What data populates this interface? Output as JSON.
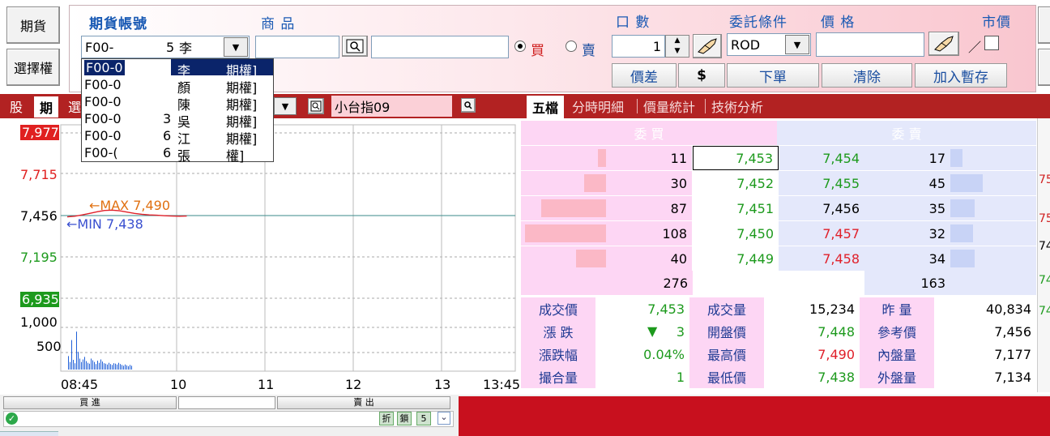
{
  "side_buttons": {
    "futures": "期貨",
    "options": "選擇權"
  },
  "top": {
    "account_label": "期貨帳號",
    "product_label": "商 品",
    "qty_label": "口 數",
    "condition_label": "委託條件",
    "price_label": "價 格",
    "market_label": "市價",
    "account_value": "F00-",
    "account_suffix": "5",
    "account_name": "李",
    "buy_label": "買",
    "sell_label": "賣",
    "qty_value": "1",
    "condition_value": "ROD",
    "price_value": "",
    "price_mark": "／"
  },
  "action_buttons": {
    "spread": "價差",
    "dollar": "$",
    "order": "下單",
    "clear": "清除",
    "add_temp": "加入暫存"
  },
  "account_dropdown": [
    {
      "id": "F00-0",
      "num": "",
      "name": "李",
      "tag": "期權]"
    },
    {
      "id": "F00-0",
      "num": "",
      "name": "顏",
      "tag": "期權]"
    },
    {
      "id": "F00-0",
      "num": "",
      "name": "陳",
      "tag": "期權]"
    },
    {
      "id": "F00-0",
      "num": "3",
      "name": "吳",
      "tag": "期權]"
    },
    {
      "id": "F00-0",
      "num": "6",
      "name": "江",
      "tag": "期權]"
    },
    {
      "id": "F00-(",
      "num": "6",
      "name": "張",
      "tag": "權]"
    }
  ],
  "left_tabs": {
    "stock": "股",
    "futures": "期",
    "options": "選",
    "product": "小台指09"
  },
  "right_tabs": [
    "五檔",
    "分時明細",
    "價量統計",
    "技術分析"
  ],
  "chart_data": {
    "type": "line",
    "yticks_price": [
      "7,977",
      "7,715",
      "7,456",
      "7,195",
      "6,935"
    ],
    "yticks_volume": [
      "1,000",
      "500"
    ],
    "xticks": [
      "08:45",
      "10",
      "11",
      "12",
      "13",
      "13:45"
    ],
    "ylim": [
      6935,
      7977
    ],
    "reference_price": 7456,
    "max_label": "MAX 7,490",
    "min_label": "MIN 7,438",
    "max_arrow": "←",
    "min_arrow": "←",
    "colors": {
      "up": "#e0202a",
      "down": "#1d9a1d",
      "line": "#3a8a8a",
      "volume": "#1f5fd8"
    },
    "price": {
      "x_minutes": [
        0,
        5,
        10,
        15,
        20,
        25,
        30,
        35,
        40,
        45,
        50,
        55,
        60,
        65,
        70,
        75,
        80
      ],
      "values": [
        7448,
        7452,
        7460,
        7470,
        7480,
        7488,
        7490,
        7486,
        7478,
        7470,
        7464,
        7460,
        7458,
        7455,
        7453,
        7452,
        7453
      ]
    },
    "volume": [
      320,
      180,
      700,
      230,
      150,
      900,
      420,
      260,
      180,
      240,
      300,
      200,
      160,
      140,
      260,
      220,
      180,
      130,
      210,
      160,
      240,
      190,
      150,
      140,
      120,
      160,
      130,
      110,
      150,
      140,
      120,
      160,
      130,
      110,
      90,
      120,
      100,
      80,
      110,
      90
    ]
  },
  "order_book": {
    "bid_header": "委 買",
    "ask_header": "委 賣",
    "rows": [
      {
        "bid_qty": "11",
        "bid": "7,453",
        "ask": "7,454",
        "ask_qty": "17",
        "ask_color": "green",
        "bid_bar": 4,
        "ask_bar": 6
      },
      {
        "bid_qty": "30",
        "bid": "7,452",
        "ask": "7,455",
        "ask_qty": "45",
        "ask_color": "green",
        "bid_bar": 11,
        "ask_bar": 16
      },
      {
        "bid_qty": "87",
        "bid": "7,451",
        "ask": "7,456",
        "ask_qty": "35",
        "ask_color": "black",
        "bid_bar": 32,
        "ask_bar": 12
      },
      {
        "bid_qty": "108",
        "bid": "7,450",
        "ask": "7,457",
        "ask_qty": "32",
        "ask_color": "red",
        "bid_bar": 40,
        "ask_bar": 11
      },
      {
        "bid_qty": "40",
        "bid": "7,449",
        "ask": "7,458",
        "ask_qty": "34",
        "ask_color": "red",
        "bid_bar": 15,
        "ask_bar": 12
      }
    ],
    "bid_total": "276",
    "ask_total": "163"
  },
  "stats": [
    {
      "l1": "成交價",
      "v1": "7,453",
      "c1": "green",
      "l2": "成交量",
      "v2": "15,234",
      "c2": "black",
      "l3": "昨 量",
      "v3": "40,834",
      "c3": "black"
    },
    {
      "l1": "漲 跌",
      "v1": "3",
      "arrow": "▼",
      "c1": "green",
      "l2": "開盤價",
      "v2": "7,448",
      "c2": "green",
      "l3": "參考價",
      "v3": "7,456",
      "c3": "black"
    },
    {
      "l1": "漲跌幅",
      "v1": "0.04%",
      "c1": "green",
      "l2": "最高價",
      "v2": "7,490",
      "c2": "red",
      "l3": "內盤量",
      "v3": "7,177",
      "c3": "black"
    },
    {
      "l1": "撮合量",
      "v1": "1",
      "c1": "green",
      "l2": "最低價",
      "v2": "7,438",
      "c2": "green",
      "l3": "外盤量",
      "v3": "7,134",
      "c3": "black"
    }
  ],
  "bottom": {
    "buy_label": "買 進",
    "sell_label": "賣 出",
    "btn1": "折",
    "btn2": "鎖",
    "btn3": "5",
    "chevron": "⌄"
  },
  "right_edge": {
    "t1": "75",
    "t2": "75",
    "t3": "74",
    "t4": "74",
    "t5": "74"
  }
}
